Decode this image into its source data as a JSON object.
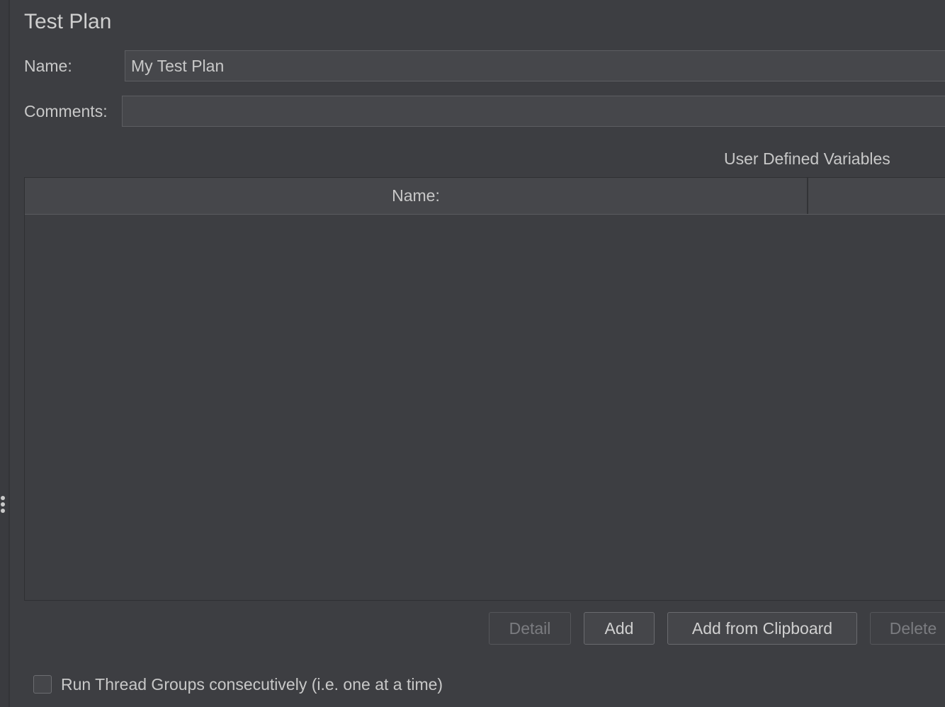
{
  "panel": {
    "title": "Test Plan"
  },
  "form": {
    "name_label": "Name:",
    "name_value": "My Test Plan",
    "comments_label": "Comments:",
    "comments_value": ""
  },
  "variables": {
    "caption": "User Defined Variables",
    "columns": [
      "Name:",
      ""
    ],
    "rows": []
  },
  "buttons": {
    "detail": "Detail",
    "add": "Add",
    "add_clipboard": "Add from Clipboard",
    "delete": "Delete"
  },
  "options": {
    "run_consecutively_label": "Run Thread Groups consecutively (i.e. one at a time)",
    "run_consecutively_checked": false
  },
  "icons": {
    "split_handle": "vertical-dots-icon"
  },
  "colors": {
    "background": "#3d3e42",
    "field_background": "#46474b",
    "text": "#c8c8c8",
    "disabled_text": "#7b7c80"
  }
}
